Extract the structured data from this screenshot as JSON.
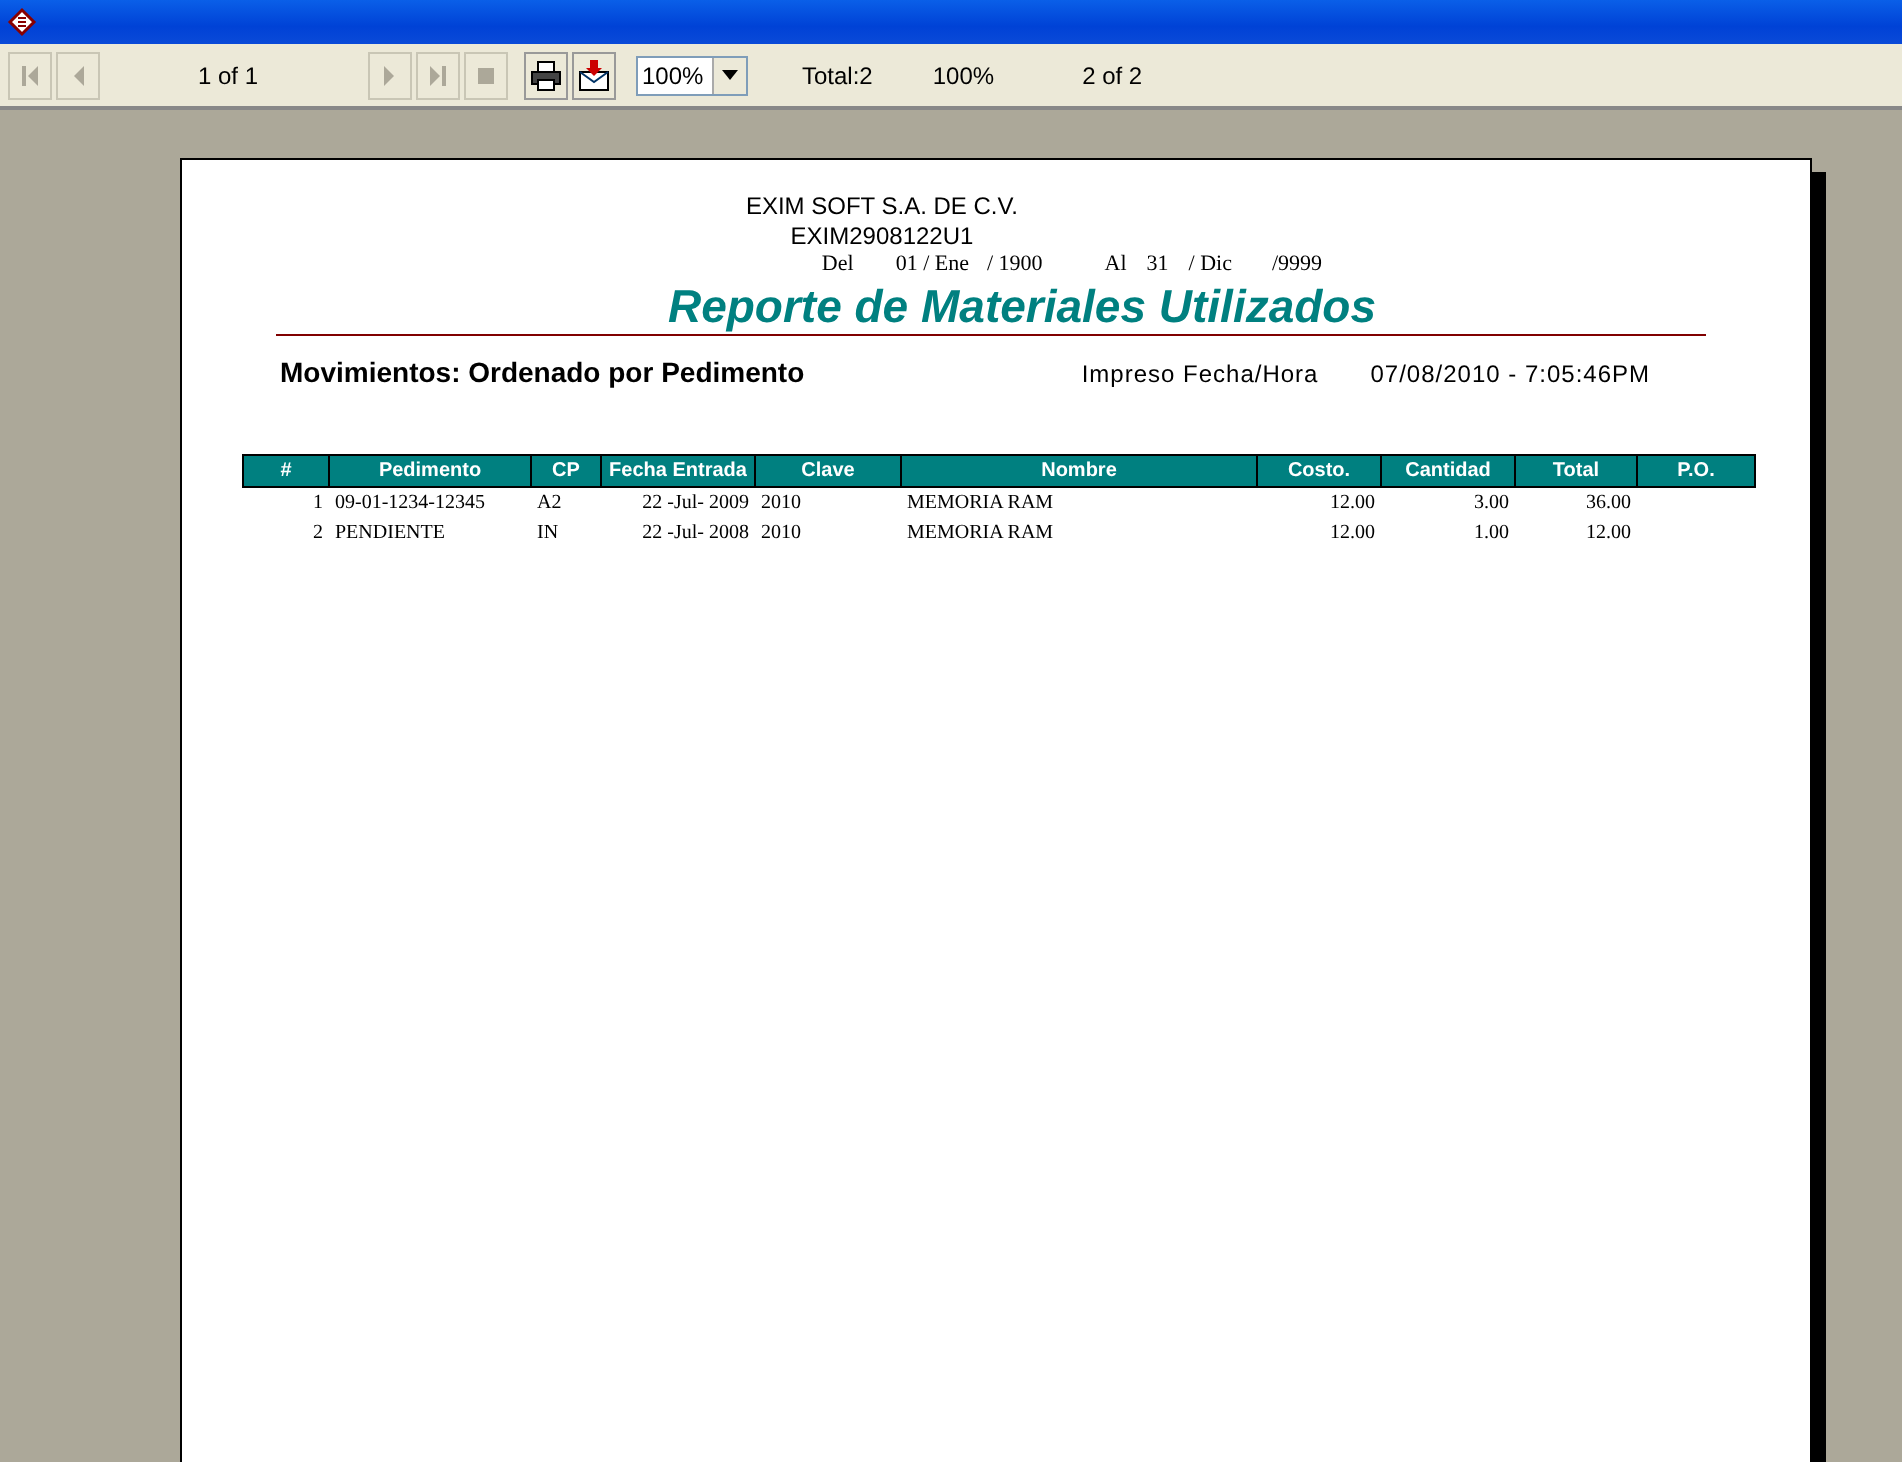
{
  "toolbar": {
    "nav_left": [
      {
        "kind": "first",
        "disabled": true
      },
      {
        "kind": "prev",
        "disabled": true
      }
    ],
    "page_of": "1 of 1",
    "nav_right": [
      {
        "kind": "next",
        "disabled": true
      },
      {
        "kind": "last",
        "disabled": true
      },
      {
        "kind": "stop",
        "disabled": true
      }
    ],
    "actions": [
      {
        "kind": "print"
      },
      {
        "kind": "export"
      }
    ],
    "zoom": "100%",
    "total": "Total:2",
    "percent": "100%",
    "page_count": "2 of 2"
  },
  "report": {
    "company": "EXIM SOFT S.A. DE C.V.",
    "rfc": "EXIM2908122U1",
    "range": [
      "Del",
      "01 / Ene",
      "/ 1900",
      "Al",
      "31",
      "/ Dic",
      "/9999"
    ],
    "title": "Reporte de Materiales Utilizados",
    "subtitle": "Movimientos: Ordenado por Pedimento",
    "printed_label": "Impreso Fecha/Hora",
    "printed_value": "07/08/2010 -  7:05:46PM",
    "table": {
      "columns": [
        "#",
        "Pedimento",
        "CP",
        "Fecha Entrada",
        "Clave",
        "Nombre",
        "Costo.",
        "Cantidad",
        "Total",
        "P.O."
      ],
      "rows": [
        [
          "1",
          "09-01-1234-12345",
          "A2",
          "22  -Jul-  2009",
          "2010",
          "MEMORIA RAM",
          "12.00",
          "3.00",
          "36.00",
          ""
        ],
        [
          "2",
          "PENDIENTE",
          "IN",
          "22  -Jul-  2008",
          "2010",
          "MEMORIA RAM",
          "12.00",
          "1.00",
          "12.00",
          ""
        ]
      ]
    }
  }
}
